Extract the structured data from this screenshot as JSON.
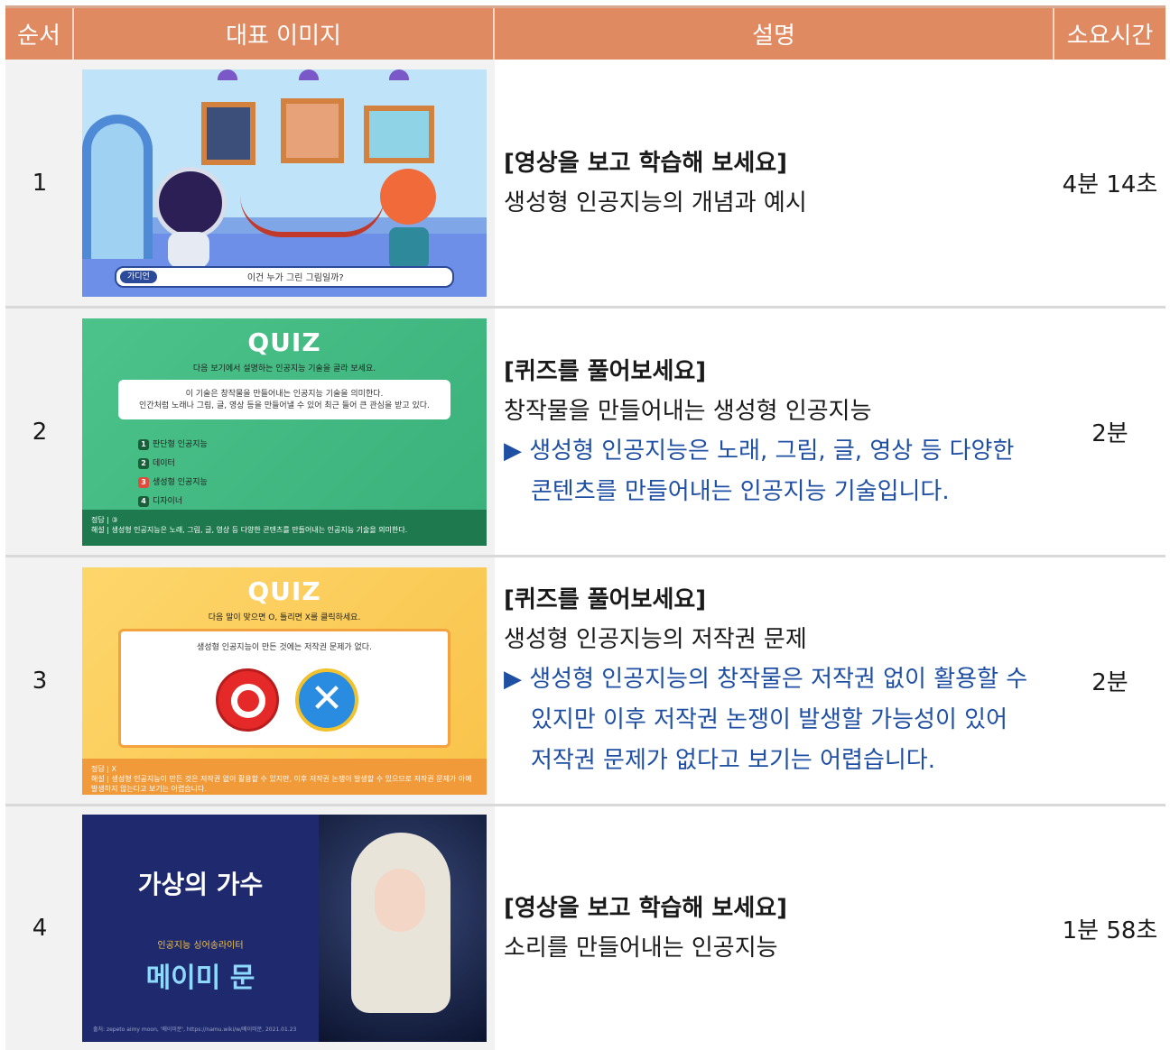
{
  "header": {
    "col_order": "순서",
    "col_image": "대표 이미지",
    "col_desc": "설명",
    "col_time": "소요시간"
  },
  "rows": [
    {
      "num": "1",
      "title": "[영상을 보고 학습해 보세요]",
      "line1": "생성형 인공지능의 개념과 예시",
      "time": "4분 14초",
      "thumb": {
        "badge": "가디언",
        "caption": "이건 누가 그린 그림일까?"
      }
    },
    {
      "num": "2",
      "title": "[퀴즈를 풀어보세요]",
      "line1": "창작물을 만들어내는 생성형 인공지능",
      "note1": "▶ 생성형 인공지능은 노래, 그림, 글, 영상 등 다양한",
      "note2": "콘텐츠를 만들어내는 인공지능 기술입니다.",
      "time": "2분",
      "thumb": {
        "logo": "QUIZ",
        "instruction": "다음 보기에서 설명하는 인공지능 기술을 골라 보세요.",
        "q1": "이 기술은 창작물을 만들어내는 인공지능 기술을 의미한다.",
        "q2": "인간처럼 노래나 그림, 글, 영상 등을 만들어낼 수 있어 최근 들어 큰 관심을 받고 있다.",
        "opt1": "판단형 인공지능",
        "opt2": "데이터",
        "opt3": "생성형 인공지능",
        "opt4": "디자이너",
        "answer_label": "정답 | ③",
        "explain": "해설 | 생성형 인공지능은 노래, 그림, 글, 영상 등 다양한 콘텐츠를 만들어내는 인공지능 기술을 의미한다."
      }
    },
    {
      "num": "3",
      "title": "[퀴즈를 풀어보세요]",
      "line1": "생성형 인공지능의 저작권 문제",
      "note1": "▶ 생성형 인공지능의 창작물은 저작권 없이 활용할 수",
      "note2": "있지만 이후 저작권 논쟁이 발생할 가능성이 있어",
      "note3": "저작권 문제가 없다고 보기는 어렵습니다.",
      "time": "2분",
      "thumb": {
        "logo": "QUIZ",
        "instruction": "다음 말이 맞으면 O, 틀리면 X를 클릭하세요.",
        "q1": "생성형 인공지능이 만든 것에는 저작권 문제가 없다.",
        "answer_label": "정답 | X",
        "explain": "해설 | 생성형 인공지능이 만든 것은 저작권 없이 활용할 수 있지만, 이후 저작권 논쟁이 발생할 수 있으므로 저작권 문제가 아예 발생하지 않는다고 보기는 어렵습니다."
      }
    },
    {
      "num": "4",
      "title": "[영상을 보고 학습해 보세요]",
      "line1": "소리를 만들어내는 인공지능",
      "time": "1분 58초",
      "thumb": {
        "big": "가상의 가수",
        "small": "인공지능 싱어송라이터",
        "name": "메이미 문",
        "src": "출처: zepeto aimy moon, '메이미문', https://namu.wiki/w/메이미문, 2021.01.23"
      }
    }
  ]
}
